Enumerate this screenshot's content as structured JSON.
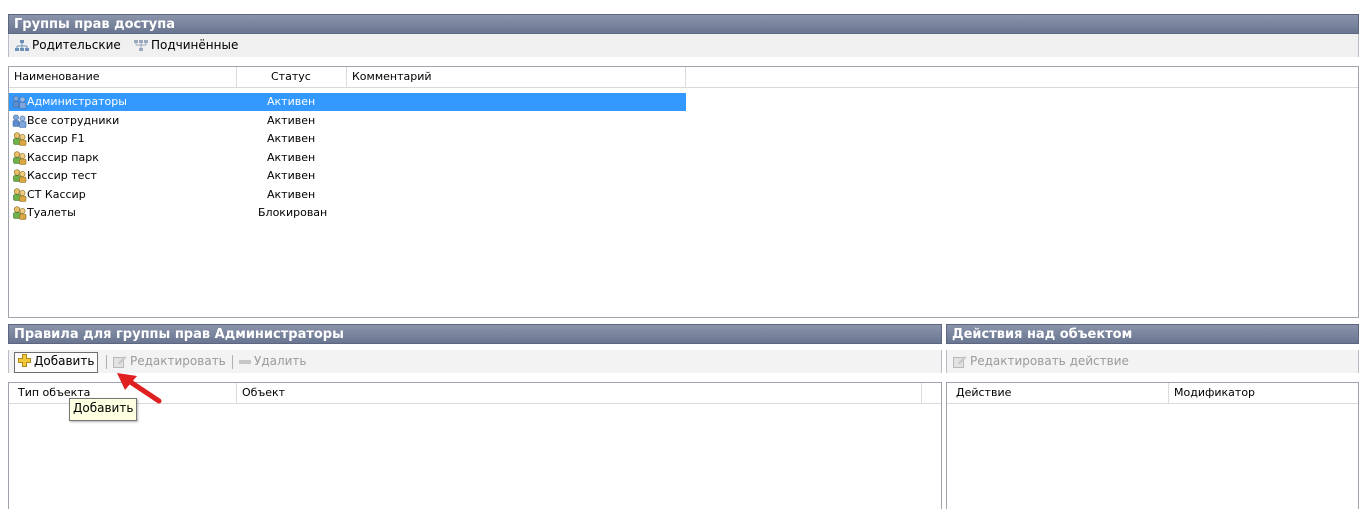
{
  "top_panel": {
    "title": "Группы прав доступа",
    "toolbar": {
      "parents": "Родительские",
      "children": "Подчинённые"
    },
    "columns": [
      "Наименование",
      "Статус",
      "Комментарий"
    ],
    "rows": [
      {
        "name": "Администраторы",
        "status": "Активен",
        "comment": "",
        "icon": "admin-group-icon",
        "selected": true
      },
      {
        "name": "Все сотрудники",
        "status": "Активен",
        "comment": "",
        "icon": "admin-group-icon"
      },
      {
        "name": "Кассир F1",
        "status": "Активен",
        "comment": "",
        "icon": "users-group-icon"
      },
      {
        "name": "Кассир парк",
        "status": "Активен",
        "comment": "",
        "icon": "users-group-icon"
      },
      {
        "name": "Кассир тест",
        "status": "Активен",
        "comment": "",
        "icon": "users-group-icon"
      },
      {
        "name": "СТ Кассир",
        "status": "Активен",
        "comment": "",
        "icon": "users-group-icon"
      },
      {
        "name": "Туалеты",
        "status": "Блокирован",
        "comment": "",
        "icon": "users-group-icon"
      }
    ]
  },
  "rules_panel": {
    "title": "Правила для группы прав Администраторы",
    "toolbar": {
      "add": "Добавить",
      "edit": "Редактировать",
      "delete": "Удалить"
    },
    "columns": [
      "Тип объекта",
      "Объект"
    ],
    "tooltip": "Добавить"
  },
  "actions_panel": {
    "title": "Действия над объектом",
    "toolbar": {
      "edit_action": "Редактировать действие"
    },
    "columns": [
      "Действие",
      "Модификатор"
    ]
  },
  "colors": {
    "header_bg": "#7a849d",
    "selection": "#3399ff",
    "arrow": "#e02020",
    "tooltip_bg": "#ffffe1"
  }
}
